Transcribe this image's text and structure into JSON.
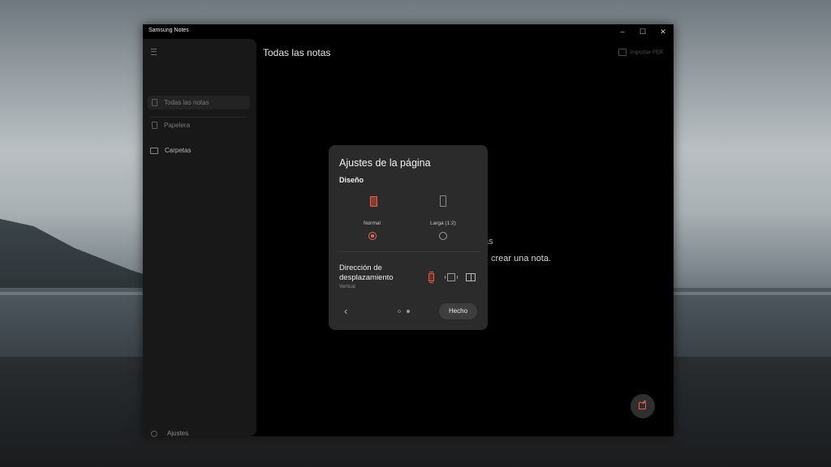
{
  "window": {
    "title": "Samsung Notes",
    "controls": {
      "minimize": "–",
      "maximize": "☐",
      "close": "✕"
    }
  },
  "sidebar": {
    "items": [
      {
        "label": "Todas las notas",
        "icon": "note-icon",
        "active": true
      },
      {
        "label": "Papelera",
        "icon": "trash-icon",
        "active": false
      }
    ],
    "folders_label": "Carpetas",
    "settings_label": "Ajustes"
  },
  "main": {
    "title": "Todas las notas",
    "import_pdf": "Importar PDF",
    "empty_line_1": "as",
    "empty_line_2": "crear una nota."
  },
  "dialog": {
    "title": "Ajustes de la página",
    "layout_section": "Diseño",
    "layout_options": [
      {
        "label": "Normal",
        "selected": true
      },
      {
        "label": "Larga (1:2)",
        "selected": false
      }
    ],
    "scroll_title": "Dirección de desplazamiento",
    "scroll_value": "Vertical",
    "scroll_options": [
      "vertical-scroll-icon",
      "horizontal-scroll-icon",
      "book-view-icon"
    ],
    "back_glyph": "‹",
    "page_indicator": {
      "pages": 2,
      "current": 2
    },
    "done_label": "Hecho"
  },
  "colors": {
    "accent": "#e66a55",
    "dialog_bg": "#2b2b2b",
    "sidebar_bg": "#181818"
  }
}
